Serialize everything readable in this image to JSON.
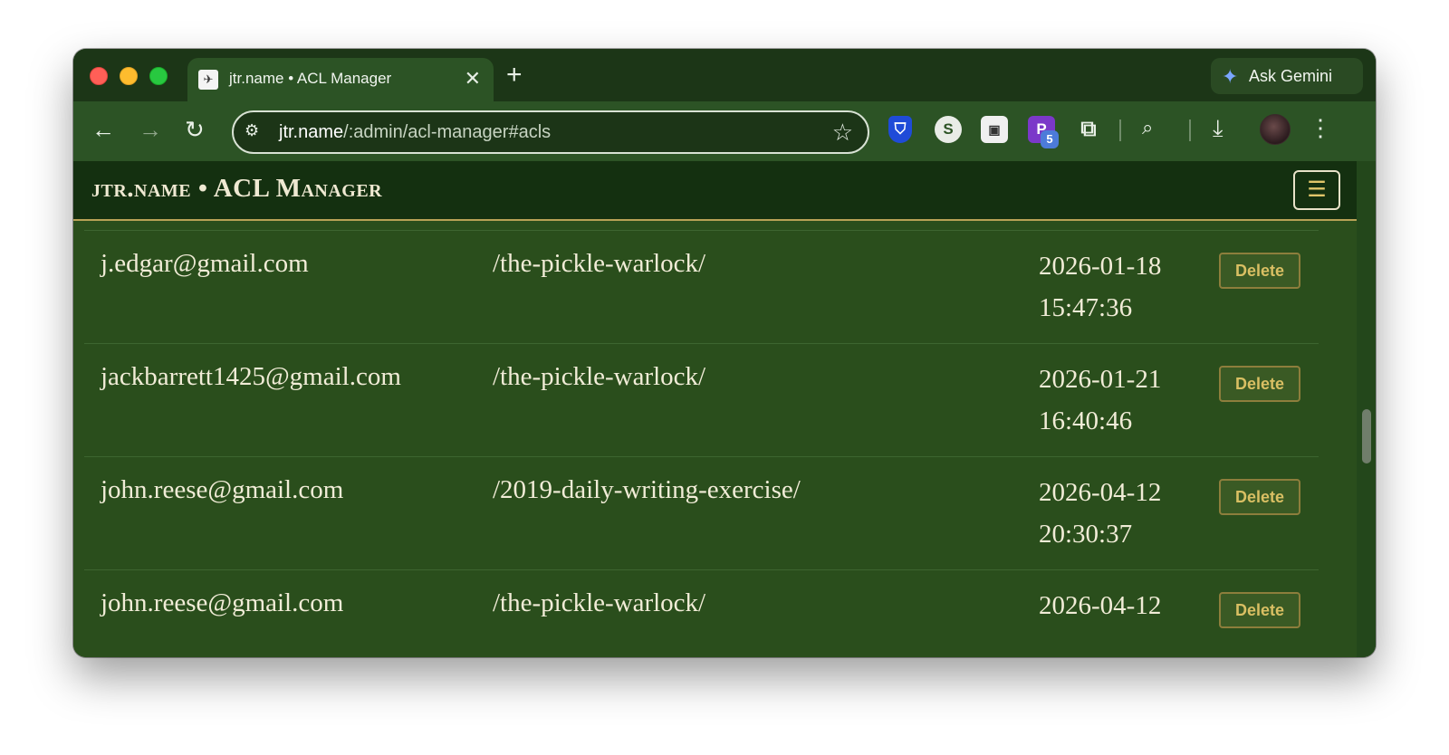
{
  "browser": {
    "tab": {
      "title": "jtr.name • ACL Manager",
      "close": "✕"
    },
    "new_tab": "+",
    "gemini_label": "Ask Gemini",
    "url_host": "jtr.name",
    "url_path": "/:admin/acl-manager#acls",
    "extension_badge": "5",
    "icons": [
      "back-arrow-icon",
      "forward-arrow-icon",
      "reload-icon",
      "site-info-icon",
      "star-icon",
      "bitwarden-icon",
      "s-extension-icon",
      "image-extension-icon",
      "p-extension-icon",
      "puzzle-icon",
      "cast-search-icon",
      "download-icon",
      "avatar",
      "kebab-menu-icon"
    ]
  },
  "app": {
    "title": "jtr.name • ACL Manager",
    "menu_icon": "☰"
  },
  "acls": [
    {
      "email": "j.edgar@gmail.com",
      "path": "/the-pickle-warlock/",
      "date": "2026-01-18",
      "time": "15:47:36",
      "action": "Delete"
    },
    {
      "email": "jackbarrett1425@gmail.com",
      "path": "/the-pickle-warlock/",
      "date": "2026-01-21",
      "time": "16:40:46",
      "action": "Delete"
    },
    {
      "email": "john.reese@gmail.com",
      "path": "/2019-daily-writing-exercise/",
      "date": "2026-04-12",
      "time": "20:30:37",
      "action": "Delete"
    },
    {
      "email": "john.reese@gmail.com",
      "path": "/the-pickle-warlock/",
      "date": "2026-04-12",
      "time": "",
      "action": "Delete"
    }
  ],
  "colors": {
    "page_bg": "#2a4e1c",
    "header_bg": "#143010",
    "accent_gold": "#d9bf63",
    "text": "#f1ecd7"
  }
}
